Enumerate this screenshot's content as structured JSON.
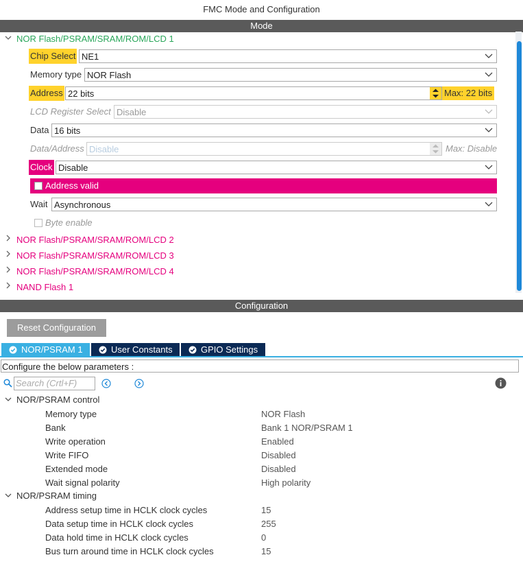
{
  "window": {
    "title": "FMC Mode and Configuration"
  },
  "mode_section": {
    "header": "Mode"
  },
  "nor_group_1": {
    "label": "NOR Flash/PSRAM/SRAM/ROM/LCD 1",
    "chip_select": {
      "label": "Chip Select",
      "value": "NE1"
    },
    "memory_type": {
      "label": "Memory type",
      "value": "NOR Flash"
    },
    "address": {
      "label": "Address",
      "value": "22 bits",
      "max": "Max: 22 bits"
    },
    "lcd_register_select": {
      "label": "LCD Register Select",
      "value": "Disable"
    },
    "data": {
      "label": "Data",
      "value": "16 bits"
    },
    "data_address": {
      "label": "Data/Address",
      "value": "Disable",
      "max": "Max: Disable"
    },
    "clock": {
      "label": "Clock",
      "value": "Disable"
    },
    "address_valid": {
      "label": "Address valid",
      "checked": false
    },
    "wait": {
      "label": "Wait",
      "value": "Asynchronous"
    },
    "byte_enable": {
      "label": "Byte enable",
      "checked": false
    }
  },
  "collapsed_groups": [
    "NOR Flash/PSRAM/SRAM/ROM/LCD 2",
    "NOR Flash/PSRAM/SRAM/ROM/LCD 3",
    "NOR Flash/PSRAM/SRAM/ROM/LCD 4",
    "NAND Flash 1"
  ],
  "config_section": {
    "header": "Configuration",
    "reset_button": "Reset Configuration"
  },
  "tabs": [
    {
      "label": "NOR/PSRAM 1",
      "active": true
    },
    {
      "label": "User Constants",
      "active": false
    },
    {
      "label": "GPIO Settings",
      "active": false
    }
  ],
  "description": "Configure the below parameters :",
  "search": {
    "placeholder": "Search (Crtl+F)"
  },
  "params": {
    "control": {
      "title": "NOR/PSRAM control",
      "rows": [
        {
          "name": "Memory type",
          "value": "NOR Flash"
        },
        {
          "name": "Bank",
          "value": "Bank 1 NOR/PSRAM 1"
        },
        {
          "name": "Write operation",
          "value": "Enabled"
        },
        {
          "name": "Write FIFO",
          "value": "Disabled"
        },
        {
          "name": "Extended mode",
          "value": "Disabled"
        },
        {
          "name": "Wait signal polarity",
          "value": "High polarity"
        }
      ]
    },
    "timing": {
      "title": "NOR/PSRAM timing",
      "rows": [
        {
          "name": "Address setup time in HCLK clock cycles",
          "value": "15"
        },
        {
          "name": "Data setup time in HCLK clock cycles",
          "value": "255"
        },
        {
          "name": "Data hold time in HCLK clock cycles",
          "value": "0"
        },
        {
          "name": "Bus turn around time in HCLK clock cycles",
          "value": "15"
        }
      ]
    }
  },
  "colors": {
    "highlight_yellow": "#ffd22c",
    "highlight_pink": "#e5007e",
    "group_green": "#2aa65a",
    "group_pink": "#e5007e",
    "tab_active": "#3ab0e2",
    "tab_inactive": "#0b2a55",
    "section_bar": "#5a5a5a"
  },
  "icons": [
    "chevron-down-icon",
    "spinner-icon",
    "search-icon",
    "prev-icon",
    "next-icon",
    "info-icon",
    "check-circle-icon"
  ]
}
